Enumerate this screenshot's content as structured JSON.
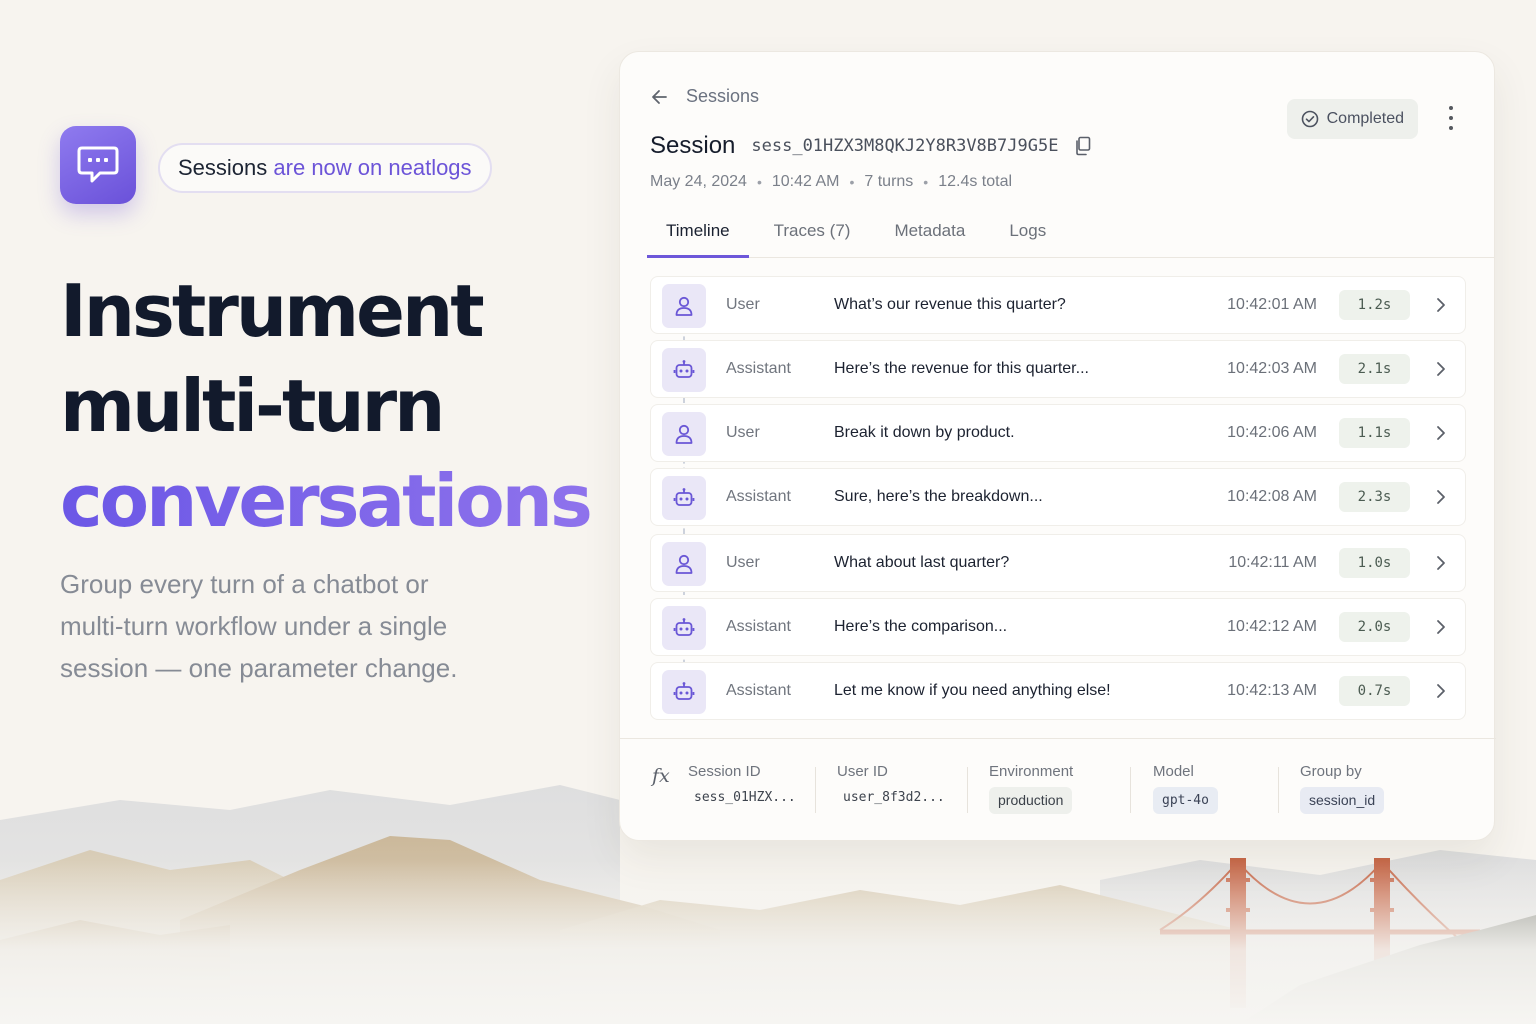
{
  "promo": {
    "pill_prefix": "Sessions",
    "pill_suffix": "are now on neatlogs",
    "headline_line1": "Instrument",
    "headline_line2": "multi-turn",
    "headline_line3": "conversations",
    "subcopy": "Group every turn of a chatbot or multi-turn workflow under a single session — one parameter change."
  },
  "session": {
    "breadcrumb": "Sessions",
    "title": "Session",
    "session_id": "sess_01HZX3M8QKJ2Y8R3V8B7J9G5E",
    "status": "Completed",
    "date": "May 24, 2024",
    "time": "10:42 AM",
    "turns_count": "7 turns",
    "total_duration": "12.4s total",
    "tabs": [
      {
        "label": "Timeline",
        "active": true
      },
      {
        "label": "Traces (7)",
        "active": false
      },
      {
        "label": "Metadata",
        "active": false
      },
      {
        "label": "Logs",
        "active": false
      }
    ],
    "turns": [
      {
        "role": "User",
        "icon": "user-icon",
        "message": "What’s our revenue this quarter?",
        "time": "10:42:01 AM",
        "duration": "1.2s"
      },
      {
        "role": "Assistant",
        "icon": "bot-icon",
        "message": "Here’s the revenue for this quarter...",
        "time": "10:42:03 AM",
        "duration": "2.1s"
      },
      {
        "role": "User",
        "icon": "user-icon",
        "message": "Break it down by product.",
        "time": "10:42:06 AM",
        "duration": "1.1s"
      },
      {
        "role": "Assistant",
        "icon": "bot-icon",
        "message": "Sure, here’s the breakdown...",
        "time": "10:42:08 AM",
        "duration": "2.3s"
      },
      {
        "role": "User",
        "icon": "user-icon",
        "message": "What about last quarter?",
        "time": "10:42:11 AM",
        "duration": "1.0s"
      },
      {
        "role": "Assistant",
        "icon": "bot-icon",
        "message": "Here’s the comparison...",
        "time": "10:42:12 AM",
        "duration": "2.0s"
      },
      {
        "role": "Assistant",
        "icon": "bot-icon",
        "message": "Let me know if you need anything else!",
        "time": "10:42:13 AM",
        "duration": "0.7s"
      }
    ],
    "footer": {
      "fx_symbol": "fx",
      "session_id_label": "Session ID",
      "session_id_value": "sess_01HZX...",
      "user_id_label": "User ID",
      "user_id_value": "user_8f3d2...",
      "environment_label": "Environment",
      "environment_value": "production",
      "model_label": "Model",
      "model_value": "gpt-4o",
      "group_by_label": "Group by",
      "group_by_value": "session_id"
    }
  },
  "colors": {
    "accent": "#6c54d8",
    "background": "#f7f4ef",
    "card": "#fdfcfa",
    "headline": "#121a2c",
    "bridge": "#c8694a"
  }
}
